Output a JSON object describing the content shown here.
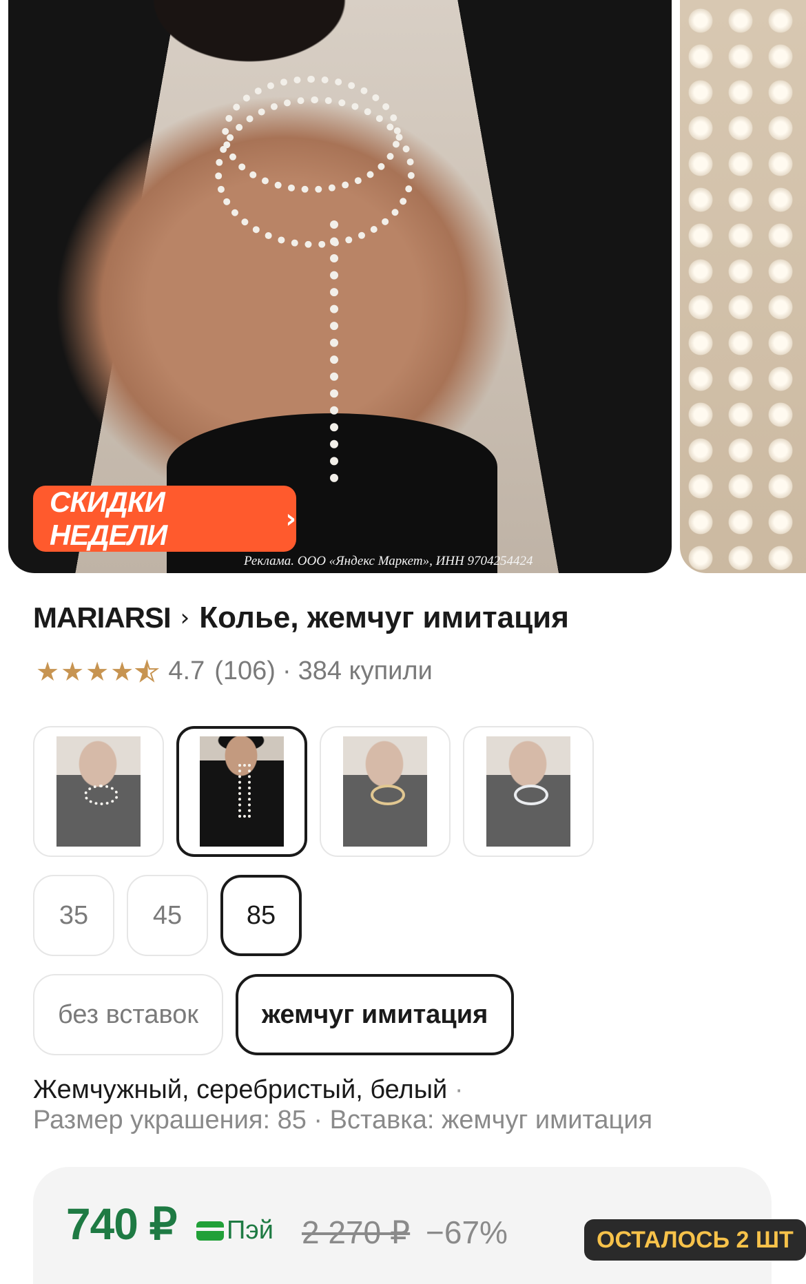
{
  "gallery": {
    "promo_badge": "СКИДКИ НЕДЕЛИ",
    "promo_arrow": "›",
    "ad_disclaimer": "Реклама. ООО «Яндекс Маркет», ИНН 9704254424"
  },
  "product": {
    "brand": "MARIARSI",
    "chevron": "›",
    "name": "Колье, жемчуг имитация",
    "rating": "4.7",
    "reviews": "(106)",
    "separator": "·",
    "bought": "384 купили",
    "stars_value": 4.5
  },
  "variants": {
    "sizes": [
      "35",
      "45",
      "85"
    ],
    "selected_size": "85",
    "inserts": [
      "без вставок",
      "жемчуг имитация"
    ],
    "selected_insert": "жемчуг имитация"
  },
  "description": {
    "line1": "Жемчужный, серебристый, белый",
    "dot": "·",
    "line2": "Размер украшения: 85 · Вставка: жемчуг имитация"
  },
  "pricing": {
    "price": "740 ₽",
    "pay_label": "Пэй",
    "old_price": "2 270 ₽",
    "discount": "−67%",
    "stock": "ОСТАЛОСЬ 2 ШТ"
  },
  "colors": {
    "accent_orange": "#ff5a2d",
    "price_green": "#1e7a43",
    "star_gold": "#c79451"
  }
}
